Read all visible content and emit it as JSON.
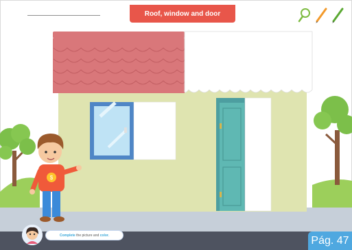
{
  "worksheet": {
    "title": "Roof, window and door",
    "page_label": "Pág. 47",
    "instruction": {
      "prefix": "Complete",
      "middle": "the picture and",
      "suffix": "color."
    }
  },
  "toolbar": {
    "tools": [
      {
        "icon": "magnifier-icon",
        "color": "#7dbb41"
      },
      {
        "icon": "pencil-orange-icon",
        "color": "#f39a2b"
      },
      {
        "icon": "pencil-green-icon",
        "color": "#5aa832"
      }
    ]
  },
  "colors": {
    "title_tab": "#e8564a",
    "roof": "#d9777a",
    "wall": "#dfe4b0",
    "door": "#5fb8b3",
    "window_frame": "#4f86c6",
    "page_badge": "#4fa8e0",
    "sidewalk": "#c6cfd9"
  }
}
